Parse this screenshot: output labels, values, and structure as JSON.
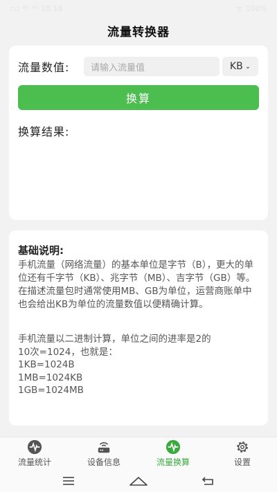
{
  "status": {
    "left": "▫▫ ⁴ᴳ ⁴ᴳ 18:18",
    "right": "ᯤ 100%"
  },
  "app": {
    "title": "流量转换器"
  },
  "converter": {
    "value_label": "流量数值:",
    "input_placeholder": "请输入流量值",
    "input_value": "",
    "unit_selected": "KB",
    "convert_button": "换算",
    "result_label": "换算结果:"
  },
  "explanation": {
    "heading": "基础说明:",
    "paragraph1": "手机流量（网络流量）的基本单位是字节（B），更大的单位还有千字节（KB）、兆字节（MB）、吉字节（GB）等。在描述流量包时通常使用MB、GB为单位，运营商账单中也会给出KB为单位的流量数值以便精确计算。",
    "paragraph2_lines": [
      "手机流量以二进制计算，单位之间的进率是2的",
      "10次=1024，也就是：",
      "1KB=1024B",
      "1MB=1024KB",
      "1GB=1024MB"
    ]
  },
  "tabs": [
    {
      "label": "流量统计",
      "icon": "pulse-circle-icon",
      "active": false
    },
    {
      "label": "设备信息",
      "icon": "router-icon",
      "active": false
    },
    {
      "label": "流量换算",
      "icon": "pulse-circle-icon",
      "active": true
    },
    {
      "label": "设置",
      "icon": "gear-icon",
      "active": false
    }
  ],
  "colors": {
    "accent": "#4cbd4f",
    "active_tab": "#3aaa3e",
    "background": "#f2f2f2"
  }
}
